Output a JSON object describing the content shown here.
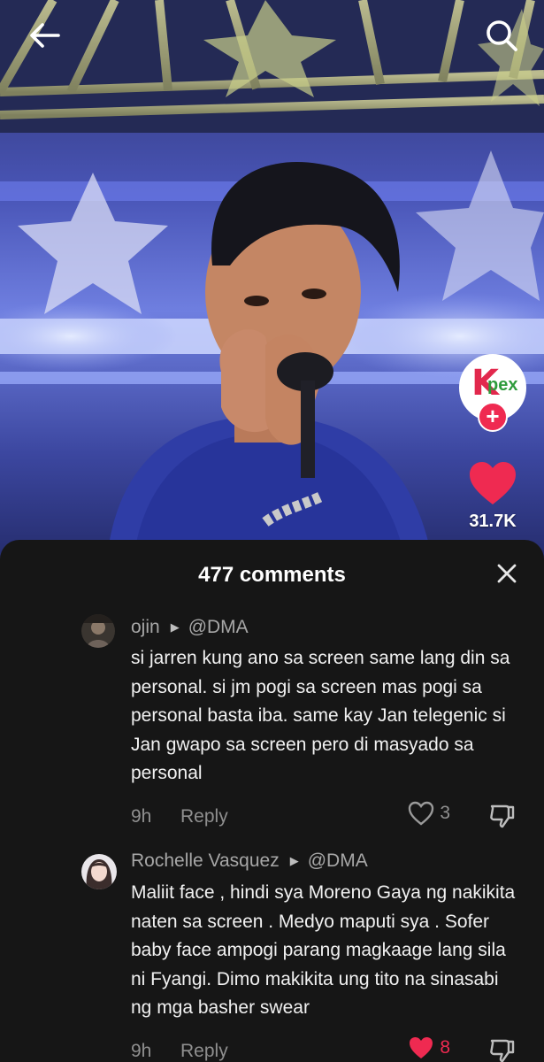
{
  "video": {
    "profile_logo_initial": "K",
    "profile_logo_text": "pex",
    "follow_label": "+",
    "like_count": "31.7K",
    "like_color": "#ef2a51"
  },
  "icons": {
    "back": "back-arrow-icon",
    "search": "search-icon",
    "close": "close-icon",
    "heart": "heart-icon",
    "dislike": "thumbs-down-icon"
  },
  "comments_sheet": {
    "title": "477 comments",
    "comments": [
      {
        "user": "ojin",
        "mention": "@DMA",
        "text": "si jarren kung ano sa screen same lang din sa personal. si jm pogi sa screen mas pogi sa personal basta iba. same kay Jan telegenic si Jan gwapo sa screen pero di masyado sa personal",
        "time": "9h",
        "reply_label": "Reply",
        "likes": "3",
        "liked": false
      },
      {
        "user": "Rochelle Vasquez",
        "mention": "@DMA",
        "text": "Maliit face , hindi sya Moreno Gaya ng nakikita naten sa screen . Medyo maputi sya . Sofer baby face ampogi parang magkaage lang sila ni Fyangi. Dimo makikita ung tito na sinasabi ng mga basher swear",
        "time": "9h",
        "reply_label": "Reply",
        "likes": "8",
        "liked": true
      }
    ]
  }
}
